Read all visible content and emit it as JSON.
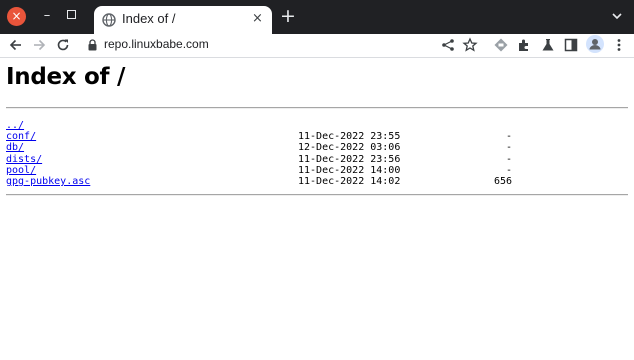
{
  "browser": {
    "tab_title": "Index of /",
    "new_tab_label": "+",
    "window_close_label": "×",
    "window_minimize_label": "–",
    "tab_close_label": "×",
    "url": "repo.linuxbabe.com"
  },
  "page": {
    "heading": "Index of /",
    "entries": [
      {
        "name": "../",
        "date": "",
        "size": ""
      },
      {
        "name": "conf/",
        "date": "11-Dec-2022 23:55",
        "size": "-"
      },
      {
        "name": "db/",
        "date": "12-Dec-2022 03:06",
        "size": "-"
      },
      {
        "name": "dists/",
        "date": "11-Dec-2022 23:56",
        "size": "-"
      },
      {
        "name": "pool/",
        "date": "11-Dec-2022 14:00",
        "size": "-"
      },
      {
        "name": "gpg-pubkey.asc",
        "date": "11-Dec-2022 14:02",
        "size": "656"
      }
    ]
  },
  "colors": {
    "tabstrip": "#202124",
    "close_button": "#e9553b",
    "link": "#0000ee"
  },
  "icons": [
    "globe-icon",
    "chevron-down-icon",
    "back-icon",
    "forward-icon",
    "reload-icon",
    "lock-icon",
    "share-icon",
    "star-icon",
    "translate-icon",
    "extensions-icon",
    "labs-icon",
    "side-panel-icon",
    "profile-icon",
    "kebab-menu-icon"
  ]
}
